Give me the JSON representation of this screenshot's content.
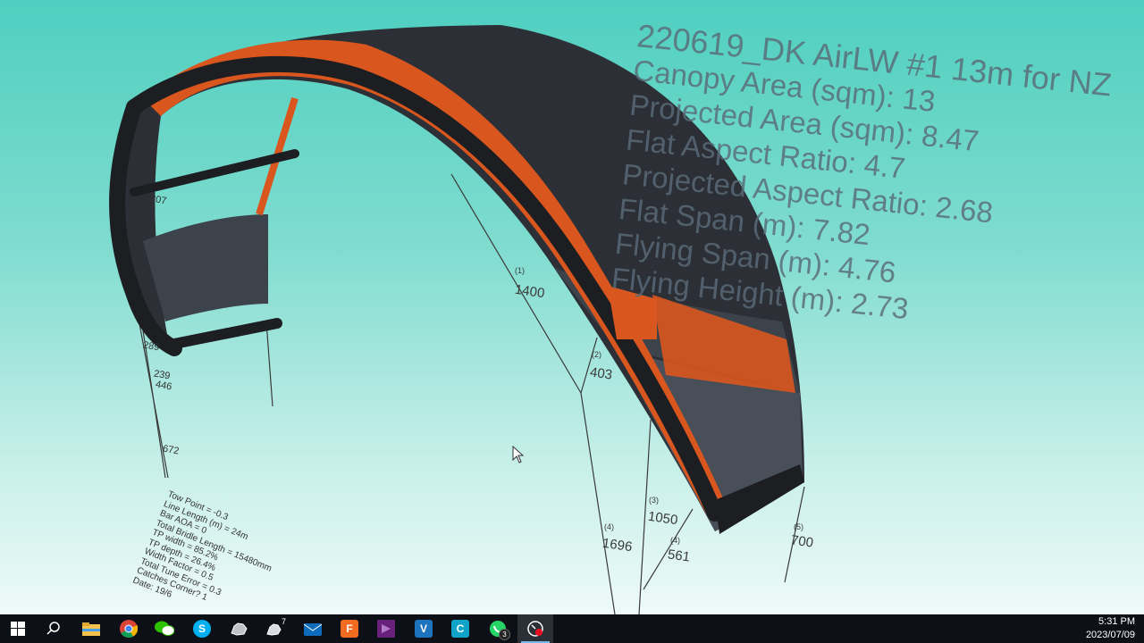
{
  "kite_specs": {
    "title": "220619_DK AirLW #1 13m for NZ",
    "lines": [
      "Canopy Area (sqm): 13",
      "Projected Area (sqm): 8.47",
      "Flat Aspect Ratio: 4.7",
      "Projected Aspect Ratio: 2.68",
      "Flat Span (m): 7.82",
      "Flying Span (m): 4.76",
      "Flying Height (m): 2.73"
    ]
  },
  "bridle_labels": {
    "b1": "(1)",
    "v1": "1400",
    "b2": "(2)",
    "v2": "403",
    "b3": "(3)",
    "v3": "1050",
    "b4": "(4)",
    "v4": "1696",
    "b5": "(4)",
    "v5": "561",
    "b6": "(5)",
    "v6": "700"
  },
  "left_numbers": [
    "207",
    "289",
    "239",
    "446",
    "672"
  ],
  "setup_info": [
    "Tow Point = -0.3",
    "Line Length (m) = 24m",
    "Bar AOA = 0",
    "Total Bridle Length = 15480mm",
    "TP width = 85.2%",
    "TP depth = 26.4%",
    "Width Factor = 0.5",
    "Total Tune Error = 0.3",
    "Catches Corner? 1",
    "Date: 19/6"
  ],
  "colors": {
    "background_top": "#4fcfc0",
    "canopy": "#2c3036",
    "leading_edge": "#d9571e",
    "taskbar": "#0d1117"
  },
  "taskbar": {
    "items": [
      {
        "name": "start-button",
        "icon": "windows-logo-icon"
      },
      {
        "name": "search-button",
        "icon": "search-icon"
      },
      {
        "name": "file-explorer",
        "icon": "folder-icon"
      },
      {
        "name": "chrome",
        "icon": "chrome-icon"
      },
      {
        "name": "wechat",
        "icon": "wechat-icon"
      },
      {
        "name": "skype",
        "icon": "skype-icon",
        "label": "S"
      },
      {
        "name": "rhino",
        "icon": "rhino-icon"
      },
      {
        "name": "rhino7",
        "icon": "rhino7-icon",
        "label": "7"
      },
      {
        "name": "outlook",
        "icon": "mail-icon"
      },
      {
        "name": "fusion360",
        "icon": "fusion-icon",
        "label": "F"
      },
      {
        "name": "visual-studio",
        "icon": "vs-icon"
      },
      {
        "name": "vectorworks",
        "icon": "vector-icon",
        "label": "V"
      },
      {
        "name": "ccleaner",
        "icon": "ccleaner-icon",
        "label": "C"
      },
      {
        "name": "whatsapp",
        "icon": "whatsapp-icon",
        "badge": "3"
      },
      {
        "name": "obs-recorder",
        "icon": "recorder-icon",
        "active": true
      }
    ],
    "time": "5:31 PM",
    "date": "2023/07/09"
  }
}
